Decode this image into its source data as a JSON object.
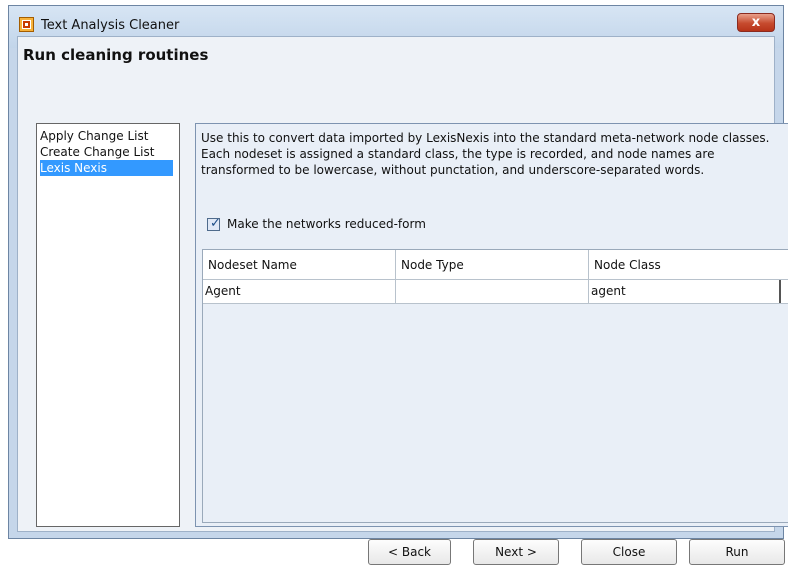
{
  "window": {
    "title": "Text Analysis Cleaner",
    "close_label": "x"
  },
  "main": {
    "heading": "Run cleaning routines"
  },
  "routines": [
    {
      "label": "Apply Change List",
      "selected": false
    },
    {
      "label": "Create Change List",
      "selected": false
    },
    {
      "label": "Lexis Nexis",
      "selected": true
    }
  ],
  "panel": {
    "description": "Use this to convert data imported by LexisNexis into the standard meta-network node classes. Each nodeset is assigned a standard class, the type is recorded, and node names are transformed to be lowercase, without punctation, and underscore-separated words.",
    "checkbox": {
      "label": "Make the networks reduced-form",
      "checked": true
    },
    "table": {
      "columns": [
        "Nodeset Name",
        "Node Type",
        "Node Class"
      ],
      "rows": [
        [
          "Agent",
          "",
          "agent"
        ]
      ]
    }
  },
  "buttons": {
    "back": "< Back",
    "next": "Next >",
    "close": "Close",
    "run": "Run"
  },
  "colors": {
    "selection": "#3399ff",
    "window_frame": "#c5d6ea",
    "close_button": "#c64a2e"
  }
}
